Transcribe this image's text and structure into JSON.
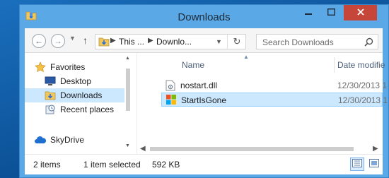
{
  "window": {
    "title": "Downloads"
  },
  "address": {
    "crumbs": [
      "This ...",
      "Downlo..."
    ]
  },
  "search": {
    "placeholder": "Search Downloads"
  },
  "sidebar": {
    "items": [
      {
        "label": "Favorites",
        "icon": "star-icon"
      },
      {
        "label": "Desktop",
        "icon": "desktop-icon"
      },
      {
        "label": "Downloads",
        "icon": "downloads-folder-icon",
        "selected": true
      },
      {
        "label": "Recent places",
        "icon": "recent-places-icon"
      },
      {
        "label": "SkyDrive",
        "icon": "skydrive-cloud-icon"
      }
    ]
  },
  "columns": [
    "Name",
    "Date modifie"
  ],
  "files": [
    {
      "name": "nostart.dll",
      "date": "12/30/2013 1",
      "icon": "dll-file-icon"
    },
    {
      "name": "StartIsGone",
      "date": "12/30/2013 1",
      "icon": "windows-logo-icon",
      "selected": true
    }
  ],
  "status": {
    "count": "2 items",
    "selection": "1 item selected",
    "size": "592 KB"
  },
  "colors": {
    "window_frame": "#5aa9e6",
    "close_button": "#c7463a",
    "selection": "#cce8ff",
    "desktop": "#0e5aa0"
  }
}
